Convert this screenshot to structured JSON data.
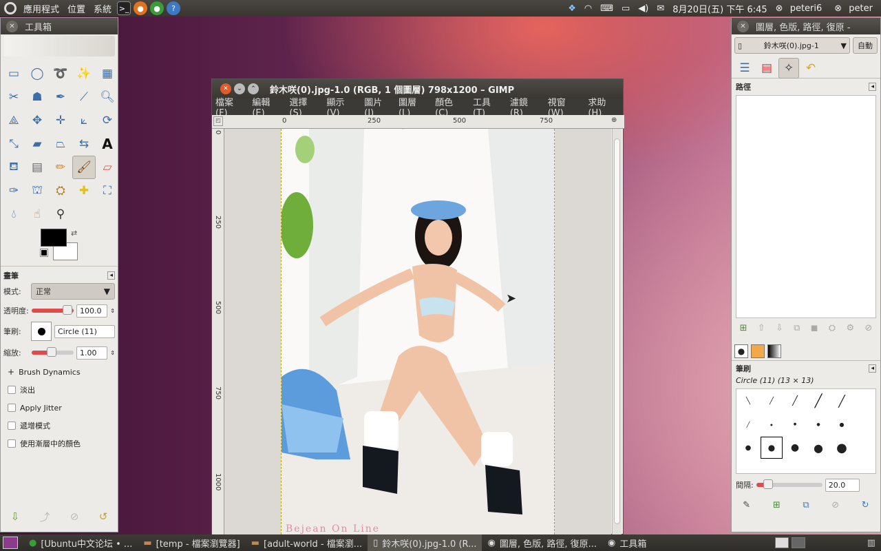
{
  "topbar": {
    "menus": [
      "應用程式",
      "位置",
      "系統"
    ],
    "datetime": "8月20日(五) 下午 6:45",
    "user1": "peteri6",
    "user2": "peter"
  },
  "toolbox": {
    "title": "工具箱",
    "brush_section": "畫筆",
    "mode_label": "模式:",
    "mode_value": "正常",
    "opacity_label": "透明度:",
    "opacity_value": "100.0",
    "brush_label": "筆刷:",
    "brush_value": "Circle (11)",
    "scale_label": "縮放:",
    "scale_value": "1.00",
    "brush_dynamics": "Brush Dynamics",
    "fade_label": "淡出",
    "jitter_label": "Apply Jitter",
    "incremental_label": "遞增模式",
    "gradient_label": "使用漸層中的顏色",
    "fg_color": "#000000",
    "bg_color": "#ffffff"
  },
  "image_window": {
    "title": "鈴木咲(0).jpg-1.0 (RGB, 1 個圖層) 798x1200 – GIMP",
    "menus": [
      "檔案(F)",
      "編輯(E)",
      "選擇(S)",
      "顯示(V)",
      "圖片(I)",
      "圖層(L)",
      "顏色(C)",
      "工具(T)",
      "濾鏡(R)",
      "視窗(W)",
      "求助(H)"
    ],
    "ruler_h": [
      "0",
      "250",
      "500",
      "750"
    ],
    "ruler_v": [
      "0",
      "250",
      "500",
      "750",
      "1000"
    ],
    "watermark": "Bejean On Line"
  },
  "layers_dock": {
    "title": "圖層, 色版, 路徑, 復原 -",
    "image_select": "鈴木咲(0).jpg-1",
    "auto_button": "自動",
    "paths_title": "路徑",
    "brushes_title": "筆刷",
    "brush_info": "Circle (11) (13 × 13)",
    "spacing_label": "間隔:",
    "spacing_value": "20.0"
  },
  "taskbar": {
    "items": [
      "[Ubuntu中文论坛 • ...",
      "[temp - 檔案瀏覽器]",
      "[adult-world - 檔案瀏...",
      "鈴木咲(0).jpg-1.0 (R...",
      "圖層, 色版, 路徑, 復原...",
      "工具箱"
    ]
  }
}
